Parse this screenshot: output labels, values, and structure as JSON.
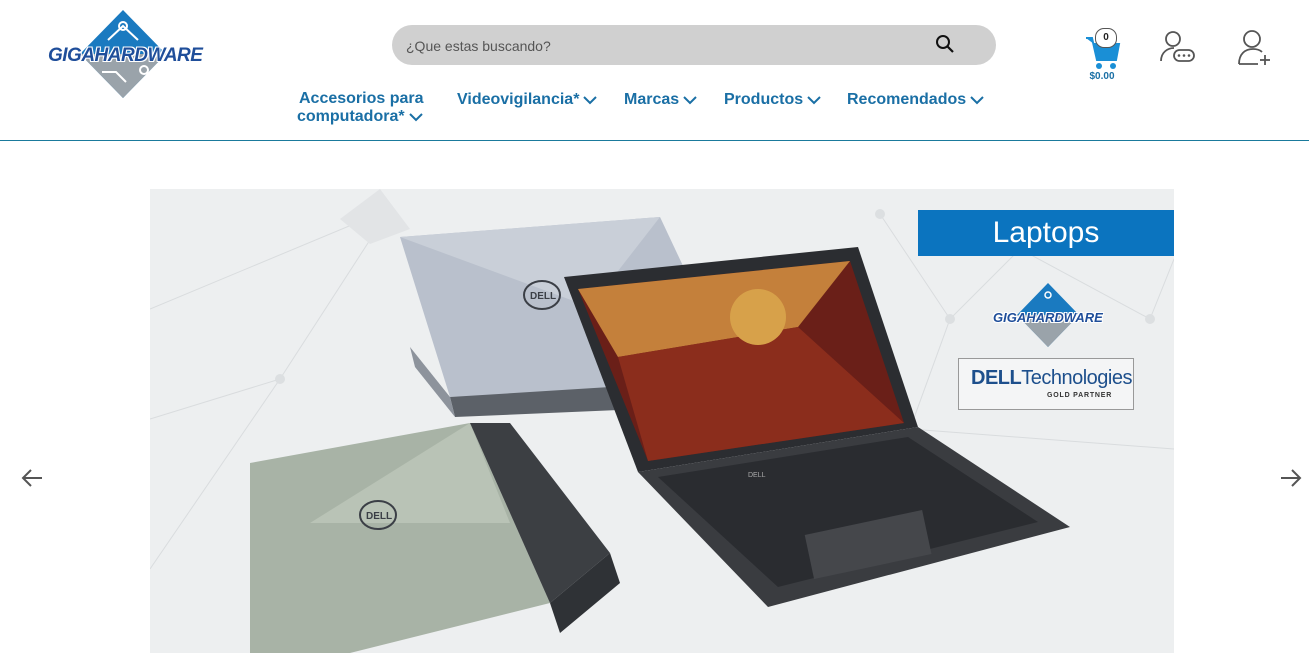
{
  "brand": {
    "logo_text": "GIGAHARDWARE"
  },
  "search": {
    "placeholder": "¿Que estas buscando?"
  },
  "cart": {
    "count": "0",
    "total": "$0.00"
  },
  "nav": [
    {
      "label_line1": "Accesorios para",
      "label_line2": "computadora*"
    },
    {
      "label": "Videovigilancia*"
    },
    {
      "label": "Marcas"
    },
    {
      "label": "Productos"
    },
    {
      "label": "Recomendados"
    }
  ],
  "banner": {
    "title": "Laptops",
    "logo_text": "GIGAHARDWARE",
    "partner_brand": "DELL",
    "partner_suffix": "Technologies",
    "partner_level": "GOLD PARTNER",
    "laptop_logo": "DELL"
  },
  "icons": {
    "search": "search-icon",
    "cart": "cart-icon",
    "login": "user-login-icon",
    "register": "user-add-icon",
    "prev": "arrow-left-icon",
    "next": "arrow-right-icon",
    "chevron": "chevron-down-icon"
  },
  "colors": {
    "brand_blue": "#1a6fa5",
    "header_rule": "#1a7a9c",
    "search_bg": "#d0d0d0",
    "banner_title_bg": "#0b74bf"
  }
}
